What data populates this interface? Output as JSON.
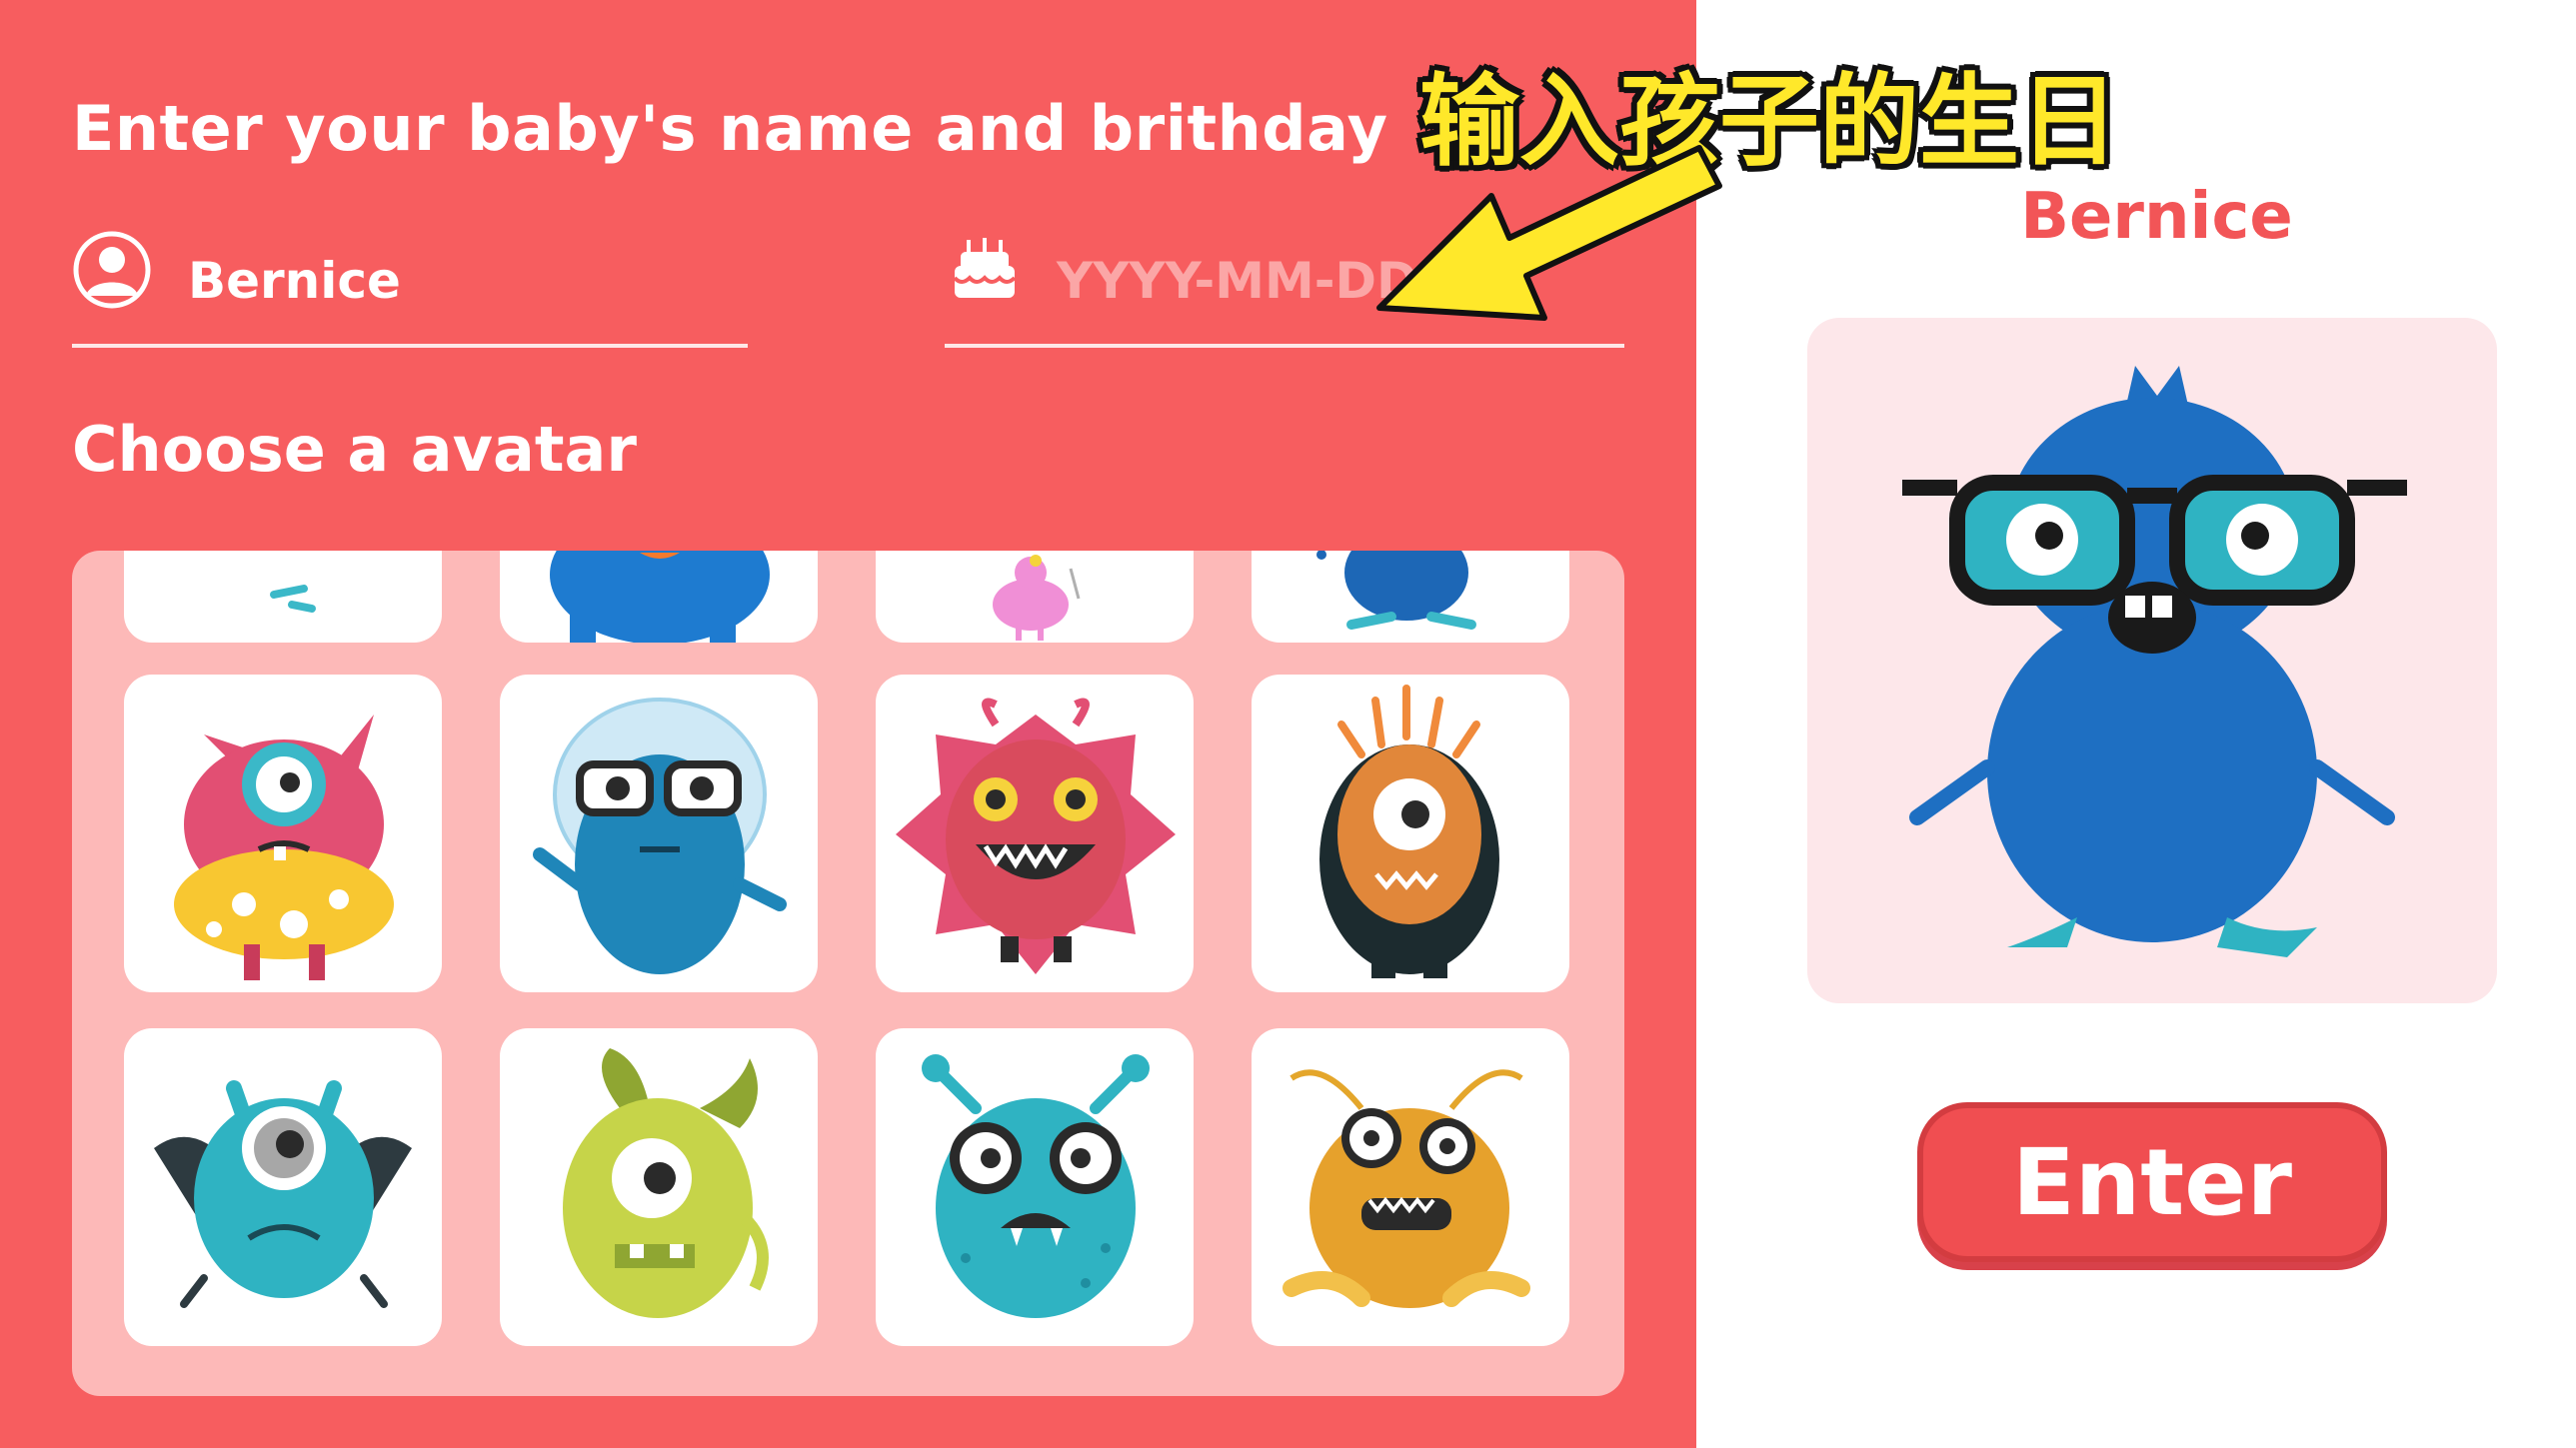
{
  "form": {
    "title": "Enter your baby's name and brithday",
    "name_value": "Bernice",
    "birthday_placeholder": "YYYY-MM-DD",
    "avatar_section_title": "Choose a avatar"
  },
  "annotation": {
    "text": "输入孩子的生日"
  },
  "preview": {
    "name": "Bernice",
    "avatar_icon": "blue-monster-with-glasses"
  },
  "enter_button": {
    "label": "Enter"
  },
  "avatars": [
    "monster-partial-1",
    "monster-partial-2",
    "monster-partial-3",
    "monster-partial-4",
    "pink-one-eyed-monster",
    "blue-astronaut-monster",
    "red-spiky-monster",
    "dark-one-eyed-monster",
    "teal-winged-monster",
    "green-one-eyed-monster",
    "teal-two-eyed-monster",
    "orange-furry-monster"
  ],
  "colors": {
    "panel_red": "#f75d5f",
    "grid_pink": "#fdb9b8",
    "accent_red": "#f25557",
    "annotation_yellow": "#ffe82a"
  }
}
